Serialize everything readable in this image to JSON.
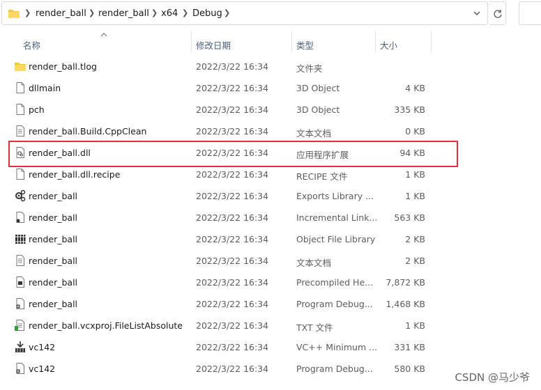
{
  "breadcrumb": [
    "render_ball",
    "render_ball",
    "x64",
    "Debug"
  ],
  "columns": {
    "name": "名称",
    "date": "修改日期",
    "type": "类型",
    "size": "大小"
  },
  "files": [
    {
      "name": "render_ball.tlog",
      "date": "2022/3/22 16:34",
      "type": "文件夹",
      "size": "",
      "icon": "folder-icon"
    },
    {
      "name": "dllmain",
      "date": "2022/3/22 16:34",
      "type": "3D Object",
      "size": "4 KB",
      "icon": "file-icon"
    },
    {
      "name": "pch",
      "date": "2022/3/22 16:34",
      "type": "3D Object",
      "size": "335 KB",
      "icon": "file-icon"
    },
    {
      "name": "render_ball.Build.CppClean",
      "date": "2022/3/22 16:34",
      "type": "文本文档",
      "size": "0 KB",
      "icon": "text-file-icon"
    },
    {
      "name": "render_ball.dll",
      "date": "2022/3/22 16:34",
      "type": "应用程序扩展",
      "size": "94 KB",
      "icon": "dll-file-icon"
    },
    {
      "name": "render_ball.dll.recipe",
      "date": "2022/3/22 16:34",
      "type": "RECIPE 文件",
      "size": "1 KB",
      "icon": "file-icon"
    },
    {
      "name": "render_ball",
      "date": "2022/3/22 16:34",
      "type": "Exports Library ...",
      "size": "1 KB",
      "icon": "exports-library-icon"
    },
    {
      "name": "render_ball",
      "date": "2022/3/22 16:34",
      "type": "Incremental Link...",
      "size": "563 KB",
      "icon": "incremental-link-icon"
    },
    {
      "name": "render_ball",
      "date": "2022/3/22 16:34",
      "type": "Object File Library",
      "size": "2 KB",
      "icon": "object-library-icon"
    },
    {
      "name": "render_ball",
      "date": "2022/3/22 16:34",
      "type": "文本文档",
      "size": "2 KB",
      "icon": "text-file-icon"
    },
    {
      "name": "render_ball",
      "date": "2022/3/22 16:34",
      "type": "Precompiled He...",
      "size": "7,872 KB",
      "icon": "precompiled-header-icon"
    },
    {
      "name": "render_ball",
      "date": "2022/3/22 16:34",
      "type": "Program Debug...",
      "size": "1,468 KB",
      "icon": "program-debug-icon"
    },
    {
      "name": "render_ball.vcxproj.FileListAbsolute",
      "date": "2022/3/22 16:34",
      "type": "TXT 文件",
      "size": "1 KB",
      "icon": "txt-file-icon"
    },
    {
      "name": "vc142",
      "date": "2022/3/22 16:34",
      "type": "VC++ Minimum ...",
      "size": "331 KB",
      "icon": "vc-minimum-icon"
    },
    {
      "name": "vc142",
      "date": "2022/3/22 16:34",
      "type": "Program Debug...",
      "size": "580 KB",
      "icon": "program-debug-icon"
    }
  ],
  "watermark": "CSDN @马少爷"
}
